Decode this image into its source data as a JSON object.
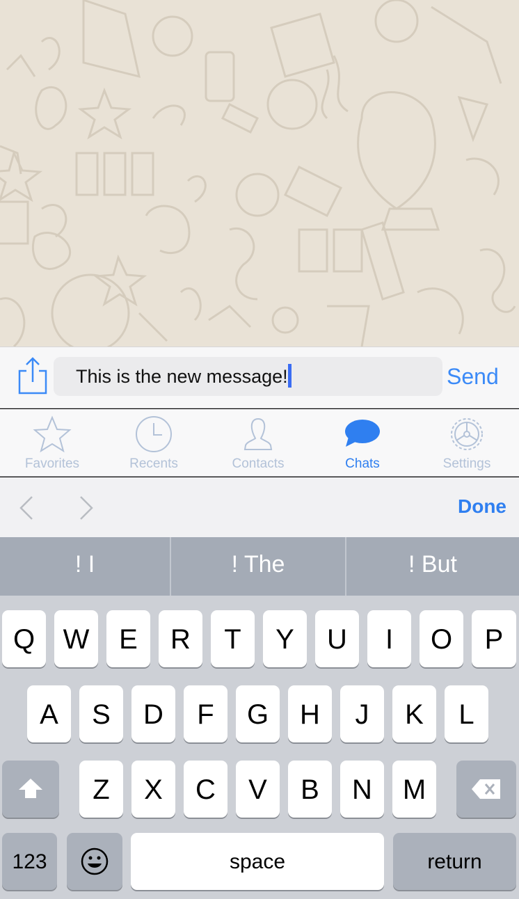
{
  "composer": {
    "share_icon": "share-icon",
    "message_value": "This is the new message!",
    "send_label": "Send"
  },
  "tabs": [
    {
      "label": "Favorites",
      "icon": "star-icon",
      "active": false
    },
    {
      "label": "Recents",
      "icon": "clock-icon",
      "active": false
    },
    {
      "label": "Contacts",
      "icon": "person-icon",
      "active": false
    },
    {
      "label": "Chats",
      "icon": "chat-bubble-icon",
      "active": true
    },
    {
      "label": "Settings",
      "icon": "gear-icon",
      "active": false
    }
  ],
  "accessory": {
    "done_label": "Done"
  },
  "suggestions": [
    "! I",
    "! The",
    "! But"
  ],
  "keyboard": {
    "row1": [
      "Q",
      "W",
      "E",
      "R",
      "T",
      "Y",
      "U",
      "I",
      "O",
      "P"
    ],
    "row2": [
      "A",
      "S",
      "D",
      "F",
      "G",
      "H",
      "J",
      "K",
      "L"
    ],
    "row3": [
      "Z",
      "X",
      "C",
      "V",
      "B",
      "N",
      "M"
    ],
    "numbers_label": "123",
    "space_label": "space",
    "return_label": "return"
  },
  "colors": {
    "accent": "#2f7ff0",
    "tab_inactive": "#b3c2d8",
    "keyboard_bg": "#cdd0d6",
    "chat_bg": "#e9e2d6"
  }
}
